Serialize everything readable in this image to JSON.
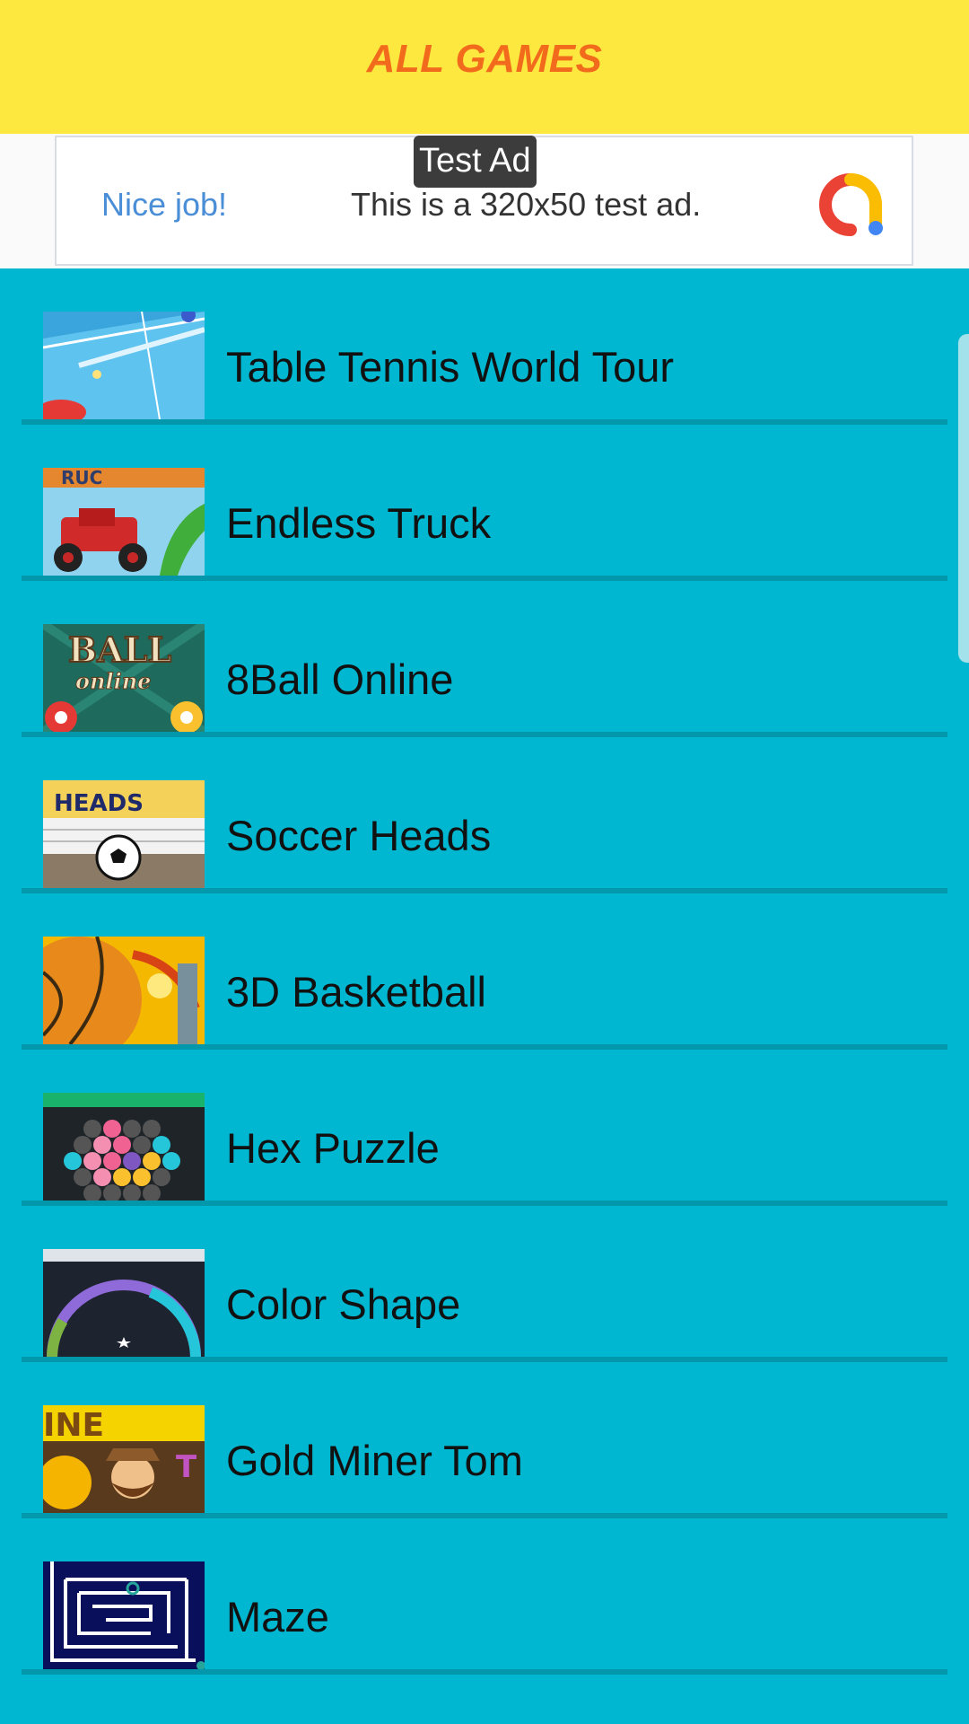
{
  "header": {
    "title": "ALL GAMES"
  },
  "ad": {
    "tag": "Test Ad",
    "left_text": "Nice job!",
    "body_text": "This is a 320x50 test ad.",
    "logo_icon": "admob-logo-icon"
  },
  "colors": {
    "header_bg": "#fde840",
    "header_title": "#f26b1d",
    "list_bg": "#00b7d1",
    "divider": "#0297ab"
  },
  "games": [
    {
      "name": "Table Tennis World Tour",
      "thumb_icon": "table-tennis-thumbnail-icon"
    },
    {
      "name": "Endless Truck",
      "thumb_icon": "truck-thumbnail-icon"
    },
    {
      "name": "8Ball Online",
      "thumb_icon": "billiards-thumbnail-icon",
      "thumb_text": "BALL",
      "thumb_subtext": "online"
    },
    {
      "name": "Soccer Heads",
      "thumb_icon": "soccer-thumbnail-icon",
      "thumb_text": "HEADS"
    },
    {
      "name": "3D Basketball",
      "thumb_icon": "basketball-thumbnail-icon"
    },
    {
      "name": "Hex Puzzle",
      "thumb_icon": "hex-puzzle-thumbnail-icon"
    },
    {
      "name": "Color Shape",
      "thumb_icon": "color-shape-thumbnail-icon"
    },
    {
      "name": "Gold Miner Tom",
      "thumb_icon": "gold-miner-thumbnail-icon"
    },
    {
      "name": "Maze",
      "thumb_icon": "maze-thumbnail-icon"
    }
  ]
}
